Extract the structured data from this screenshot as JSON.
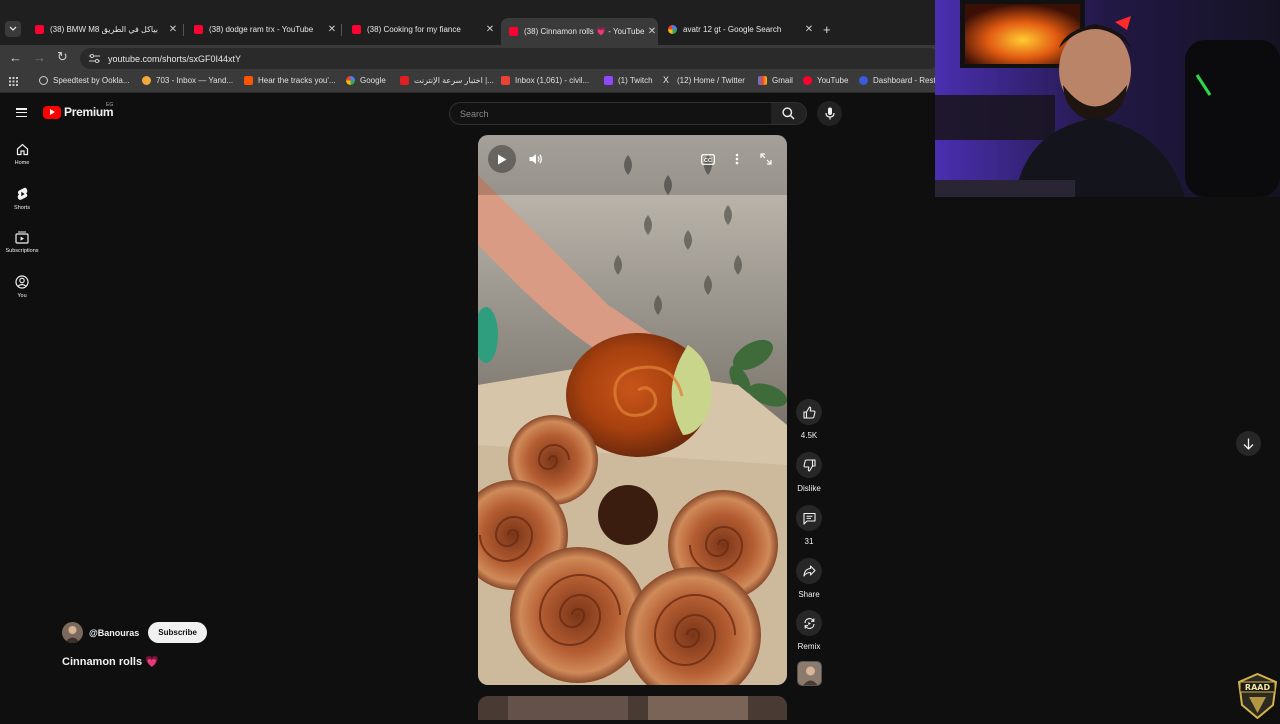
{
  "browser": {
    "tabs": [
      {
        "title": "(38) BMW M8 بياكل في الطريق",
        "favicon": "youtube",
        "active": false
      },
      {
        "title": "(38) dodge ram trx - YouTube",
        "favicon": "youtube",
        "active": false
      },
      {
        "title": "(38) Cooking for my fiance",
        "favicon": "youtube",
        "active": false
      },
      {
        "title": "(38) Cinnamon rolls 💗 - YouTube",
        "favicon": "youtube",
        "active": true
      },
      {
        "title": "avatr 12 gt - Google Search",
        "favicon": "google",
        "active": false
      }
    ],
    "new_tab_label": "+",
    "url": "youtube.com/shorts/sxGF0I44xtY",
    "bookmarks": [
      {
        "label": "Speedtest by Ookla...",
        "color": "#cfcfcf"
      },
      {
        "label": "703 - Inbox — Yand...",
        "color": "#f2a93b"
      },
      {
        "label": "Hear the tracks you'...",
        "color": "#ff5500"
      },
      {
        "label": "Google",
        "color": "#4285f4"
      },
      {
        "label": "اختبار سرعة الإنترنت |...",
        "color": "#e02020"
      },
      {
        "label": "Inbox (1,061) - civil...",
        "color": "#ea4335"
      },
      {
        "label": "(1) Twitch",
        "color": "#9146ff"
      },
      {
        "label": "(12) Home / Twitter",
        "color": "#e8e8e8"
      },
      {
        "label": "Gmail",
        "color": "#ea4335"
      },
      {
        "label": "YouTube",
        "color": "#ff0033"
      },
      {
        "label": "Dashboard - Rest",
        "color": "#3b5bdb"
      }
    ]
  },
  "youtube": {
    "logo_text": "Premium",
    "country_code": "EG",
    "search_placeholder": "Search",
    "guide": [
      {
        "label": "Home",
        "icon": "home-icon"
      },
      {
        "label": "Shorts",
        "icon": "shorts-icon"
      },
      {
        "label": "Subscriptions",
        "icon": "subscriptions-icon"
      },
      {
        "label": "You",
        "icon": "you-icon"
      }
    ],
    "actions": {
      "like_count": "4.5K",
      "dislike_label": "Dislike",
      "comment_count": "31",
      "share_label": "Share",
      "remix_label": "Remix"
    },
    "channel": {
      "handle": "@Banouras",
      "subscribe_label": "Subscribe"
    },
    "short_title": "Cinnamon rolls 💗"
  },
  "colors": {
    "background": "#0f0f0f",
    "youtube_red": "#ff0000",
    "tabstrip": "#1f1f1f",
    "toolbar": "#3a3a3a"
  }
}
